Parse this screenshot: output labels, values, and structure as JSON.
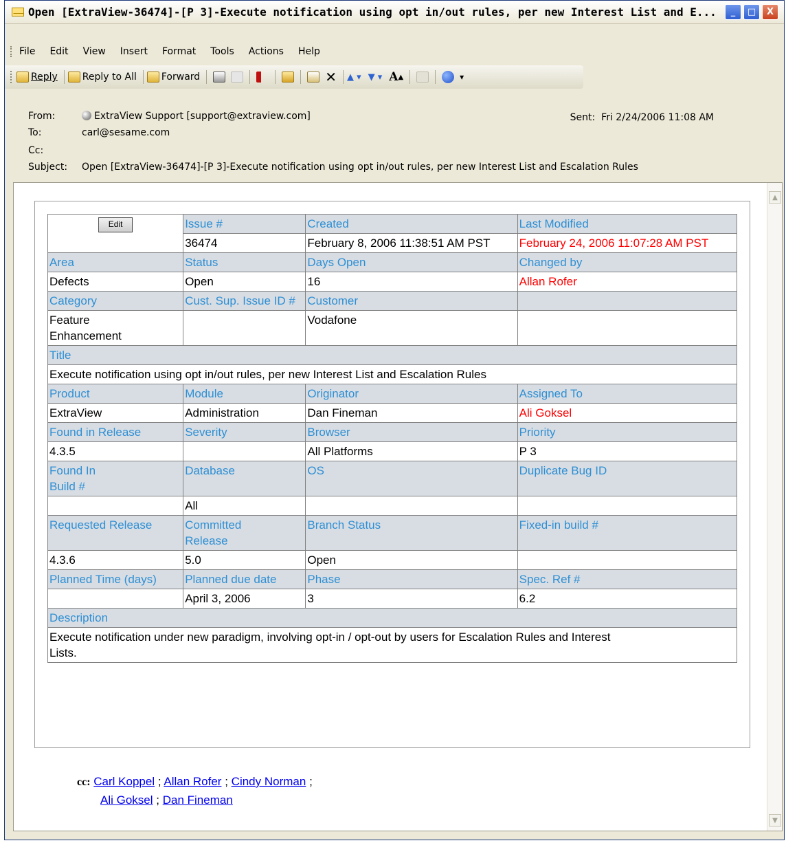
{
  "window": {
    "title": "Open [ExtraView-36474]-[P 3]-Execute notification using opt in/out rules, per new Interest List and E...",
    "minimize": "_",
    "maximize": "□",
    "close": "X"
  },
  "menu": [
    "File",
    "Edit",
    "View",
    "Insert",
    "Format",
    "Tools",
    "Actions",
    "Help"
  ],
  "toolbar": {
    "reply": "Reply",
    "reply_all": "Reply to All",
    "forward": "Forward",
    "font_size": "A",
    "more": "▾"
  },
  "header": {
    "from_label": "From:",
    "from_value": "ExtraView Support [support@extraview.com]",
    "to_label": "To:",
    "to_value": "carl@sesame.com",
    "cc_label": "Cc:",
    "cc_value": "",
    "subject_label": "Subject:",
    "subject_value": "Open [ExtraView-36474]-[P 3]-Execute notification using opt in/out rules, per new Interest List and Escalation Rules",
    "sent_label": "Sent:",
    "sent_value": "Fri 2/24/2006 11:08 AM"
  },
  "issue": {
    "edit_button": "Edit",
    "issue_no_label": "Issue #",
    "issue_no": "36474",
    "created_label": "Created",
    "created": "February 8, 2006 11:38:51 AM PST",
    "last_modified_label": "Last Modified",
    "last_modified": "February 24, 2006 11:07:28 AM PST",
    "area_label": "Area",
    "area": "Defects",
    "status_label": "Status",
    "status": "Open",
    "days_open_label": "Days Open",
    "days_open": "16",
    "changed_by_label": "Changed by",
    "changed_by": "Allan Rofer",
    "category_label": "Category",
    "category": "Feature Enhancement",
    "cust_sup_label": "Cust. Sup. Issue ID #",
    "cust_sup": "",
    "customer_label": "Customer",
    "customer": "Vodafone",
    "title_label": "Title",
    "title": "Execute notification using opt in/out rules, per new Interest List and Escalation Rules",
    "product_label": "Product",
    "product": "ExtraView",
    "module_label": "Module",
    "module": "Administration",
    "originator_label": "Originator",
    "originator": "Dan Fineman",
    "assigned_label": "Assigned To",
    "assigned": "Ali Goksel",
    "found_release_label": "Found in Release",
    "found_release": "4.3.5",
    "severity_label": "Severity",
    "severity": "",
    "browser_label": "Browser",
    "browser": "All Platforms",
    "priority_label": "Priority",
    "priority": "P 3",
    "found_build_label": "Found In Build #",
    "found_build": "",
    "database_label": "Database",
    "database": "All",
    "os_label": "OS",
    "os": "",
    "dup_label": "Duplicate Bug ID",
    "dup": "",
    "req_release_label": "Requested Release",
    "req_release": "4.3.6",
    "committed_label": "Committed Release",
    "committed": "5.0",
    "branch_label": "Branch Status",
    "branch": "Open",
    "fixed_build_label": "Fixed-in build #",
    "fixed_build": "",
    "planned_time_label": "Planned Time (days)",
    "planned_time": "",
    "due_label": "Planned due date",
    "due": "April 3, 2006",
    "phase_label": "Phase",
    "phase": "3",
    "spec_label": "Spec. Ref #",
    "spec": "6.2",
    "description_label": "Description",
    "description": "Execute notification under new paradigm, involving opt-in / opt-out by users for Escalation Rules and Interest Lists."
  },
  "cc": {
    "label": "cc:",
    "people": [
      "Carl Koppel",
      "Allan Rofer",
      "Cindy Norman",
      "Ali Goksel",
      "Dan Fineman"
    ],
    "separator": ";"
  },
  "colors": {
    "label_bg": "#d8dde3",
    "label_text": "#2e8fd4",
    "highlight_text": "#ff0000",
    "link": "#0000ee"
  }
}
